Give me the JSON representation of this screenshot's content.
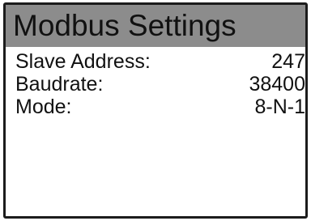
{
  "screen": {
    "title": "Modbus Settings"
  },
  "settings": [
    {
      "label": "Slave Address:",
      "value": "247"
    },
    {
      "label": "Baudrate:",
      "value": "38400"
    },
    {
      "label": "Mode:",
      "value": "8-N-1"
    }
  ],
  "colors": {
    "title_bar_background": "#8c8c8c",
    "border": "#1c1c1c",
    "text": "#111111",
    "background": "#ffffff"
  }
}
